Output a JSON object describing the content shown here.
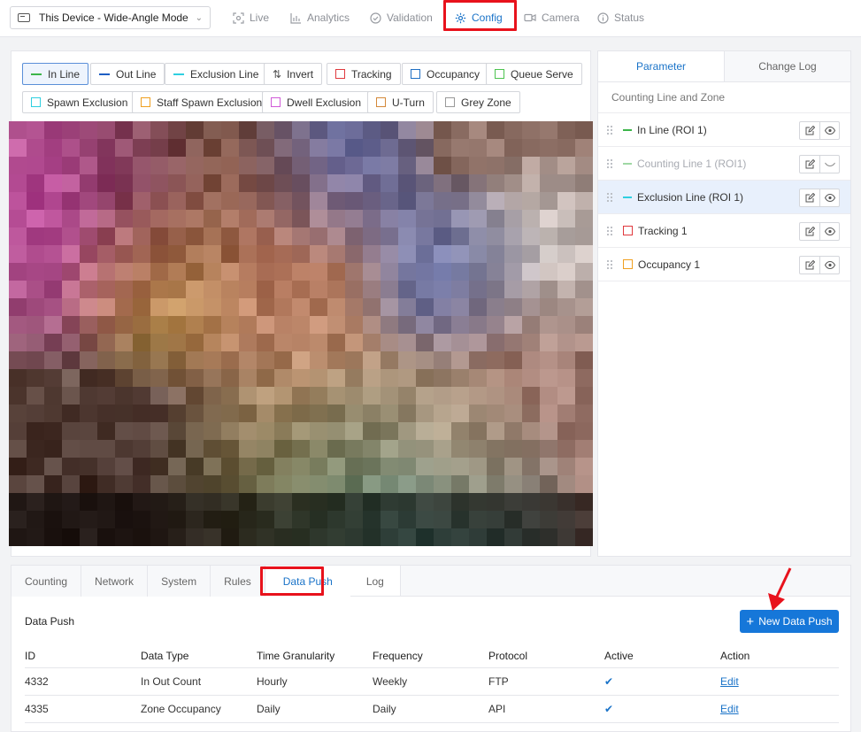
{
  "header": {
    "device_selector": "This Device - Wide-Angle Mode",
    "nav": [
      {
        "label": "Live",
        "icon": "focus-icon"
      },
      {
        "label": "Analytics",
        "icon": "bar-chart-icon"
      },
      {
        "label": "Validation",
        "icon": "check-circle-icon"
      },
      {
        "label": "Config",
        "icon": "gear-icon",
        "active": true
      },
      {
        "label": "Camera",
        "icon": "video-camera-icon"
      },
      {
        "label": "Status",
        "icon": "info-icon"
      }
    ]
  },
  "toolbar": {
    "tools": [
      {
        "label": "In Line",
        "kind": "line",
        "color": "#3cb54a",
        "active": true
      },
      {
        "label": "Out Line",
        "kind": "line",
        "color": "#1f5fc4"
      },
      {
        "label": "Exclusion Line",
        "kind": "line",
        "color": "#2fcfe0"
      },
      {
        "label": "Invert",
        "kind": "invert",
        "color": "#555555"
      },
      {
        "label": "Tracking",
        "kind": "box",
        "color": "#e0393e"
      },
      {
        "label": "Occupancy",
        "kind": "box",
        "color": "#1f6fc4"
      },
      {
        "label": "Queue Serve",
        "kind": "box",
        "color": "#4cc34f"
      },
      {
        "label": "Spawn Exclusion",
        "kind": "box",
        "color": "#2fcfe0"
      },
      {
        "label": "Staff Spawn Exclusion",
        "kind": "box",
        "color": "#f0a020"
      },
      {
        "label": "Dwell Exclusion",
        "kind": "box",
        "color": "#d05ad8"
      },
      {
        "label": "U-Turn",
        "kind": "box",
        "color": "#d4893a"
      },
      {
        "label": "Grey Zone",
        "kind": "box",
        "color": "#999999"
      }
    ]
  },
  "parameter_panel": {
    "tabs": [
      {
        "label": "Parameter",
        "active": true
      },
      {
        "label": "Change Log"
      }
    ],
    "section_title": "Counting Line and Zone",
    "items": [
      {
        "label": "In Line (ROI 1)",
        "kind": "line",
        "color": "#3cb54a",
        "visible": true
      },
      {
        "label": "Counting Line 1 (ROI1)",
        "kind": "line",
        "color": "#9fd8a4",
        "visible": false,
        "dimmed": true
      },
      {
        "label": "Exclusion Line (ROI 1)",
        "kind": "line",
        "color": "#2fcfe0",
        "visible": true,
        "selected": true
      },
      {
        "label": "Tracking 1",
        "kind": "box",
        "color": "#e0393e",
        "visible": true
      },
      {
        "label": "Occupancy 1",
        "kind": "box",
        "color": "#f0a020",
        "visible": true
      }
    ]
  },
  "settings": {
    "tabs": [
      {
        "label": "Counting"
      },
      {
        "label": "Network"
      },
      {
        "label": "System"
      },
      {
        "label": "Rules"
      },
      {
        "label": "Data Push",
        "active": true
      },
      {
        "label": "Log"
      }
    ],
    "data_push": {
      "title": "Data Push",
      "new_button": "New Data Push",
      "columns": [
        "ID",
        "Data Type",
        "Time Granularity",
        "Frequency",
        "Protocol",
        "Active",
        "Action"
      ],
      "rows": [
        {
          "id": "4332",
          "data_type": "In Out Count",
          "granularity": "Hourly",
          "frequency": "Weekly",
          "protocol": "FTP",
          "active": true,
          "action": "Edit"
        },
        {
          "id": "4335",
          "data_type": "Zone Occupancy",
          "granularity": "Daily",
          "frequency": "Daily",
          "protocol": "API",
          "active": true,
          "action": "Edit"
        }
      ]
    }
  },
  "colors": {
    "accent": "#1a73c8",
    "highlight": "#e8121c",
    "primary_button": "#1677d9"
  }
}
